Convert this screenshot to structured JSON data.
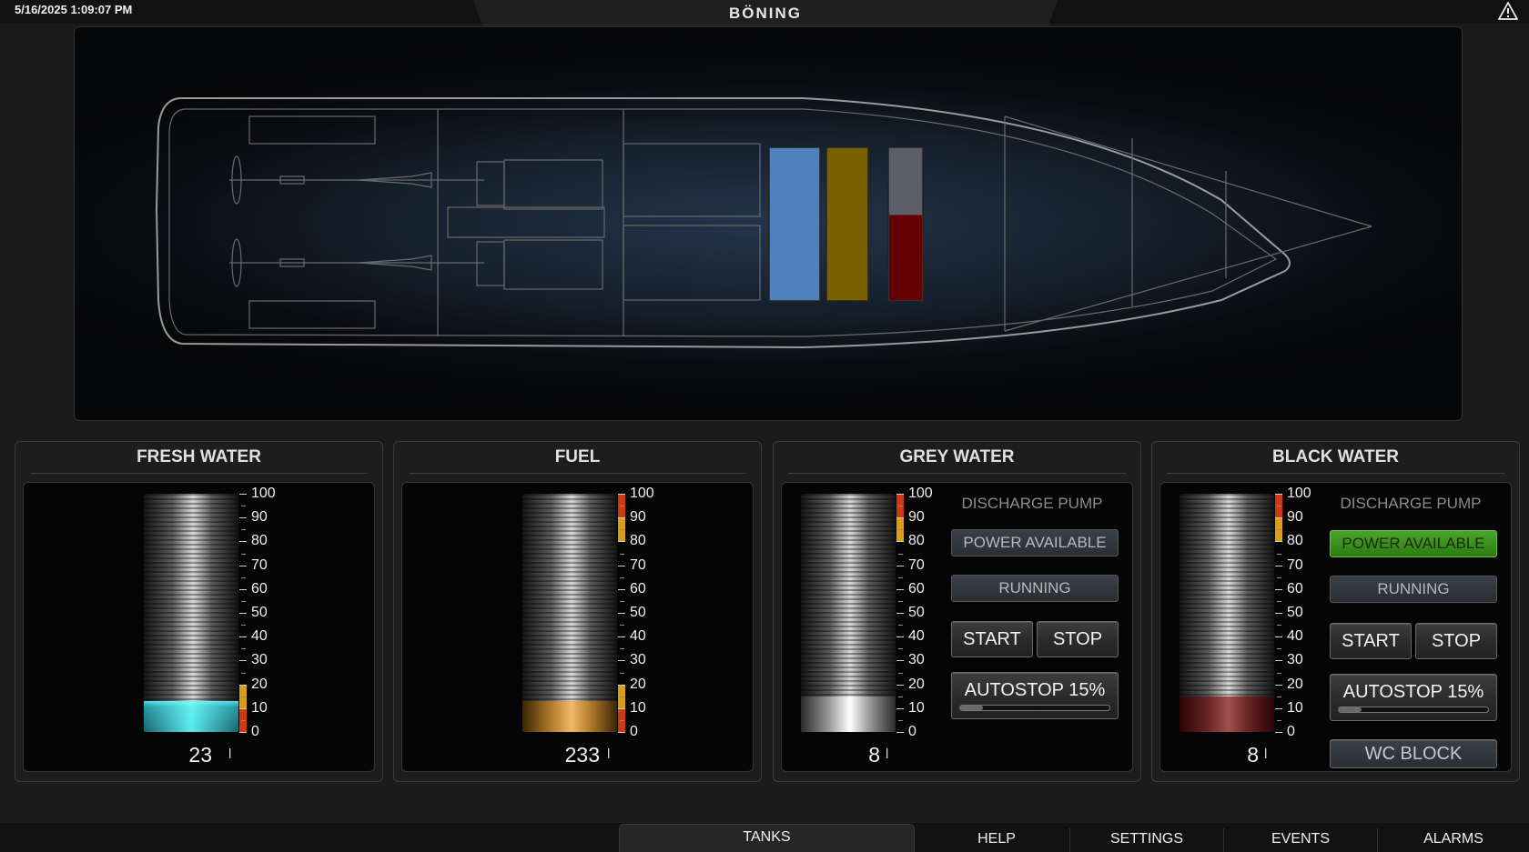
{
  "header": {
    "datetime": "5/16/2025 1:09:07 PM",
    "logo": "BÖNING",
    "warning_icon": "warning-triangle-icon"
  },
  "boat": {
    "tank_colors": {
      "fresh_water": "#4f81bd",
      "fuel": "#7a6000",
      "grey_water": "#5c5f69",
      "black_water": "#660000"
    },
    "fill_levels": {
      "fresh_water": 1.0,
      "fuel": 1.0,
      "black_water": 0.56
    }
  },
  "tanks": {
    "fresh_water": {
      "title": "FRESH WATER",
      "value": "23",
      "unit": "l",
      "level_percent": 13
    },
    "fuel": {
      "title": "FUEL",
      "value": "233",
      "unit": "l",
      "level_percent": 13
    },
    "grey_water": {
      "title": "GREY WATER",
      "value": "8",
      "unit": "l",
      "level_percent": 15,
      "pump_label": "DISCHARGE PUMP",
      "power_available": "POWER AVAILABLE",
      "power_on": false,
      "running": "RUNNING",
      "start": "START",
      "stop": "STOP",
      "autostop": "AUTOSTOP 15%",
      "autostop_percent": 15
    },
    "black_water": {
      "title": "BLACK WATER",
      "value": "8",
      "unit": "l",
      "level_percent": 15,
      "pump_label": "DISCHARGE PUMP",
      "power_available": "POWER AVAILABLE",
      "power_on": true,
      "running": "RUNNING",
      "start": "START",
      "stop": "STOP",
      "autostop": "AUTOSTOP 15%",
      "autostop_percent": 15,
      "wc_block": "WC BLOCK"
    }
  },
  "scale_labels": [
    "100",
    "90",
    "80",
    "70",
    "60",
    "50",
    "40",
    "30",
    "20",
    "10",
    "0"
  ],
  "nav": {
    "tanks": "TANKS",
    "help": "HELP",
    "settings": "SETTINGS",
    "events": "EVENTS",
    "alarms": "ALARMS"
  }
}
